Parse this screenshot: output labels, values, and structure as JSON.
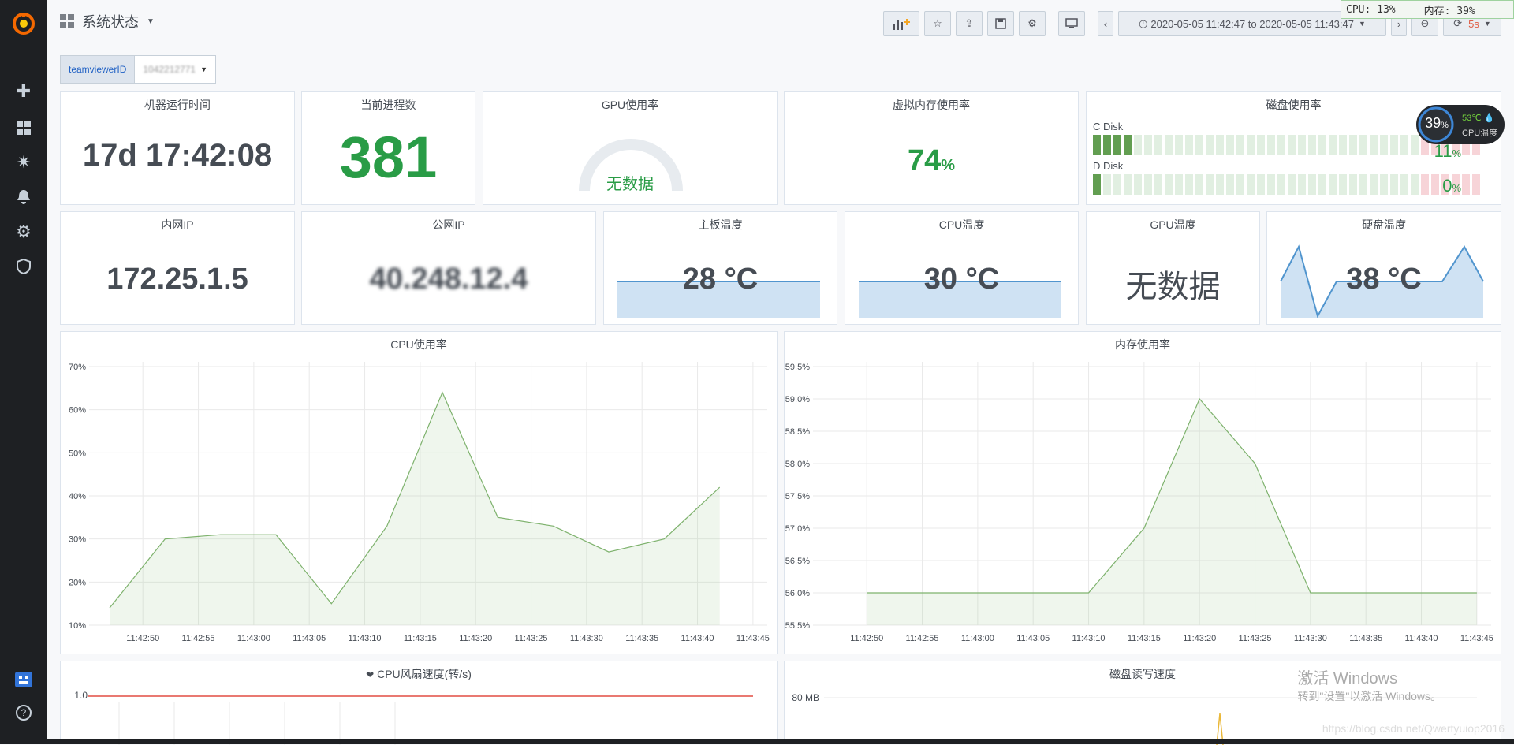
{
  "app": {
    "dashboard_title": "系统状态"
  },
  "toolbar": {
    "time_range": "2020-05-05 11:42:47 to 2020-05-05 11:43:47",
    "refresh_interval": "5s"
  },
  "overlay_monitor": {
    "cpu_label": "CPU: 13%",
    "mem_label": "内存: 39%"
  },
  "variables": {
    "label": "teamviewerID",
    "value": "1042212771"
  },
  "panels": {
    "uptime": {
      "title": "机器运行时间",
      "value": "17d 17:42:08"
    },
    "processes": {
      "title": "当前进程数",
      "value": "381"
    },
    "gpu_usage": {
      "title": "GPU使用率",
      "value": "无数据"
    },
    "virtual_mem": {
      "title": "虚拟内存使用率",
      "value": "74",
      "unit": "%"
    },
    "disk_usage": {
      "title": "磁盘使用率",
      "disks": [
        {
          "name": "C Disk",
          "pct": "11",
          "unit": "%",
          "filled": 4
        },
        {
          "name": "D Disk",
          "pct": "0",
          "unit": "%",
          "filled": 1
        }
      ]
    },
    "lan_ip": {
      "title": "内网IP",
      "value": "172.25.1.5"
    },
    "public_ip": {
      "title": "公网IP",
      "value": "40.248.12.4"
    },
    "board_temp": {
      "title": "主板温度",
      "value": "28 °C"
    },
    "cpu_temp": {
      "title": "CPU温度",
      "value": "30 °C"
    },
    "gpu_temp": {
      "title": "GPU温度",
      "value": "无数据"
    },
    "hdd_temp": {
      "title": "硬盘温度",
      "value": "38 °C"
    },
    "fan": {
      "title": "CPU风扇速度(转/s)"
    },
    "disk_io": {
      "title": "磁盘读写速度"
    }
  },
  "cpu_widget": {
    "pct": "39",
    "unit": "%",
    "temp": "53℃",
    "label": "CPU温度"
  },
  "watermark": {
    "line1": "激活 Windows",
    "line2": "转到\"设置\"以激活 Windows。",
    "csdn": "https://blog.csdn.net/Qwertyuiop2016"
  },
  "colors": {
    "green": "#299c46",
    "series": "#7eb26d",
    "red": "#e24d42",
    "stat_blue": "#5195ce"
  },
  "chart_data": [
    {
      "type": "area",
      "title": "CPU使用率",
      "x": [
        "11:42:50",
        "11:42:55",
        "11:43:00",
        "11:43:05",
        "11:43:10",
        "11:43:15",
        "11:43:20",
        "11:43:25",
        "11:43:30",
        "11:43:35",
        "11:43:40",
        "11:43:45"
      ],
      "points": [
        {
          "t": "11:42:47",
          "v": 14
        },
        {
          "t": "11:42:52",
          "v": 30
        },
        {
          "t": "11:42:57",
          "v": 31
        },
        {
          "t": "11:43:02",
          "v": 31
        },
        {
          "t": "11:43:07",
          "v": 15
        },
        {
          "t": "11:43:12",
          "v": 33
        },
        {
          "t": "11:43:17",
          "v": 64
        },
        {
          "t": "11:43:22",
          "v": 35
        },
        {
          "t": "11:43:27",
          "v": 33
        },
        {
          "t": "11:43:32",
          "v": 27
        },
        {
          "t": "11:43:37",
          "v": 30
        },
        {
          "t": "11:43:42",
          "v": 42
        }
      ],
      "y_ticks": [
        "10%",
        "20%",
        "30%",
        "40%",
        "50%",
        "60%",
        "70%"
      ],
      "ylim": [
        10,
        70
      ]
    },
    {
      "type": "area",
      "title": "内存使用率",
      "x": [
        "11:42:50",
        "11:42:55",
        "11:43:00",
        "11:43:05",
        "11:43:10",
        "11:43:15",
        "11:43:20",
        "11:43:25",
        "11:43:30",
        "11:43:35",
        "11:43:40",
        "11:43:45"
      ],
      "points": [
        {
          "t": "11:42:50",
          "v": 56.0
        },
        {
          "t": "11:42:55",
          "v": 56.0
        },
        {
          "t": "11:43:00",
          "v": 56.0
        },
        {
          "t": "11:43:05",
          "v": 56.0
        },
        {
          "t": "11:43:10",
          "v": 56.0
        },
        {
          "t": "11:43:15",
          "v": 57.0
        },
        {
          "t": "11:43:20",
          "v": 59.0
        },
        {
          "t": "11:43:25",
          "v": 58.0
        },
        {
          "t": "11:43:30",
          "v": 56.0
        },
        {
          "t": "11:43:35",
          "v": 56.0
        },
        {
          "t": "11:43:40",
          "v": 56.0
        },
        {
          "t": "11:43:45",
          "v": 56.0
        }
      ],
      "y_ticks": [
        "55.5%",
        "56.0%",
        "56.5%",
        "57.0%",
        "57.5%",
        "58.0%",
        "58.5%",
        "59.0%",
        "59.5%"
      ],
      "ylim": [
        55.5,
        59.5
      ]
    },
    {
      "type": "line",
      "title": "CPU风扇速度(转/s)",
      "y_ticks": [
        "1.0"
      ],
      "value": 1.0
    },
    {
      "type": "line",
      "title": "磁盘读写速度",
      "y_ticks": [
        "80 MB"
      ]
    }
  ]
}
